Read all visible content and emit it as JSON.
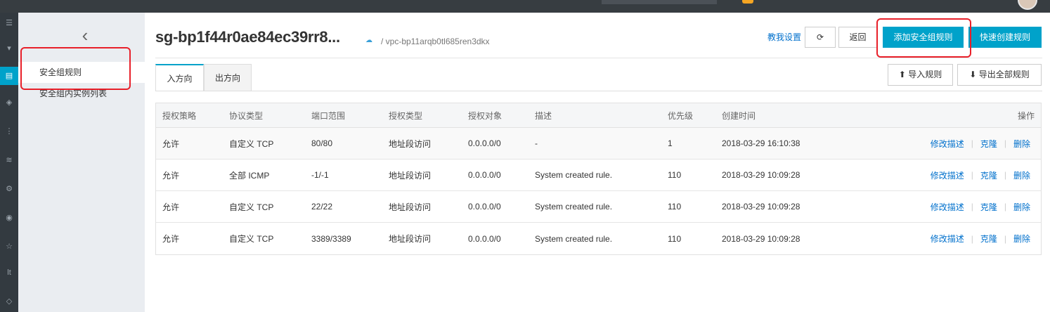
{
  "sidebar": {
    "items": [
      {
        "label": "安全组规则"
      },
      {
        "label": "安全组内实例列表"
      }
    ]
  },
  "header": {
    "title": "sg-bp1f44r0ae84ec39rr8...",
    "vpc_path": "/ vpc-bp11arqb0tl685ren3dkx",
    "help_link": "教我设置",
    "back_label": "返回",
    "add_rule_label": "添加安全组规则",
    "quick_create_label": "快速创建规则"
  },
  "tabs": [
    {
      "label": "入方向",
      "active": true
    },
    {
      "label": "出方向",
      "active": false
    }
  ],
  "actions": {
    "import_label": "导入规则",
    "export_label": "导出全部规则"
  },
  "table": {
    "headers": [
      "授权策略",
      "协议类型",
      "端口范围",
      "授权类型",
      "授权对象",
      "描述",
      "优先级",
      "创建时间",
      "操作"
    ],
    "rows": [
      {
        "policy": "允许",
        "protocol": "自定义 TCP",
        "port": "80/80",
        "auth_type": "地址段访问",
        "target": "0.0.0.0/0",
        "desc": "-",
        "priority": "1",
        "created": "2018-03-29 16:10:38"
      },
      {
        "policy": "允许",
        "protocol": "全部 ICMP",
        "port": "-1/-1",
        "auth_type": "地址段访问",
        "target": "0.0.0.0/0",
        "desc": "System created rule.",
        "priority": "110",
        "created": "2018-03-29 10:09:28"
      },
      {
        "policy": "允许",
        "protocol": "自定义 TCP",
        "port": "22/22",
        "auth_type": "地址段访问",
        "target": "0.0.0.0/0",
        "desc": "System created rule.",
        "priority": "110",
        "created": "2018-03-29 10:09:28"
      },
      {
        "policy": "允许",
        "protocol": "自定义 TCP",
        "port": "3389/3389",
        "auth_type": "地址段访问",
        "target": "0.0.0.0/0",
        "desc": "System created rule.",
        "priority": "110",
        "created": "2018-03-29 10:09:28"
      }
    ],
    "row_actions": {
      "edit": "修改描述",
      "clone": "克隆",
      "delete": "删除",
      "separator": "|"
    }
  },
  "colors": {
    "accent": "#00a2ca",
    "link": "#0070cc",
    "highlight": "#e8202a"
  }
}
